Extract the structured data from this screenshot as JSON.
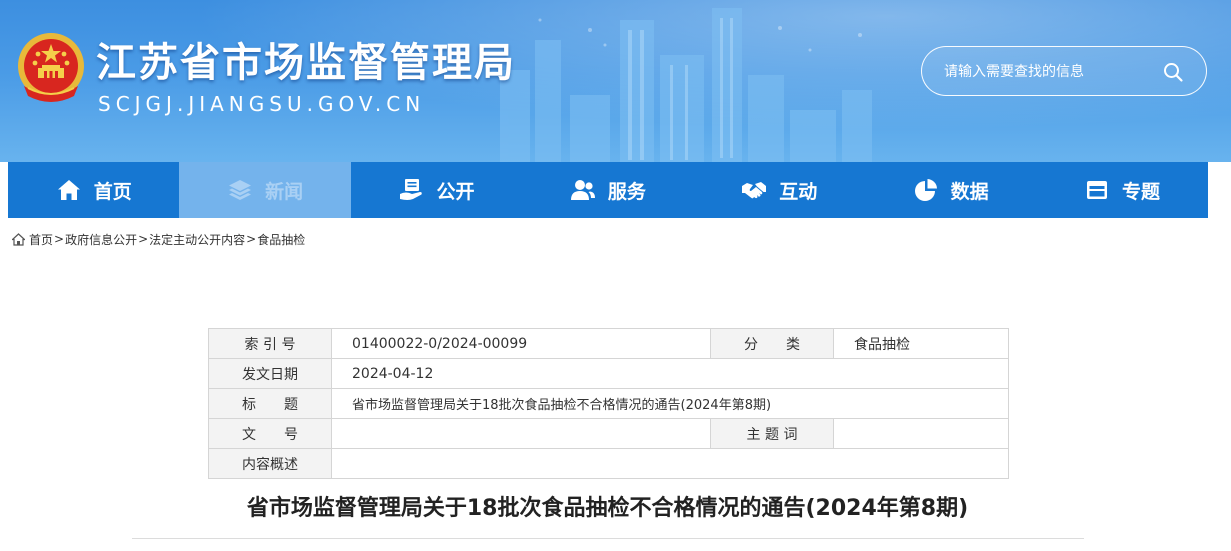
{
  "header": {
    "site_title": "江苏省市场监督管理局",
    "site_domain": "SCJGJ.JIANGSU.GOV.CN",
    "search_placeholder": "请输入需要查找的信息",
    "search_icon": "search-icon"
  },
  "nav": {
    "items": [
      {
        "label": "首页",
        "icon": "home-icon"
      },
      {
        "label": "新闻",
        "icon": "layers-icon",
        "active": true
      },
      {
        "label": "公开",
        "icon": "document-hand-icon"
      },
      {
        "label": "服务",
        "icon": "users-icon"
      },
      {
        "label": "互动",
        "icon": "handshake-icon"
      },
      {
        "label": "数据",
        "icon": "pie-chart-icon"
      },
      {
        "label": "专题",
        "icon": "window-icon"
      }
    ]
  },
  "breadcrumb": {
    "icon": "home-icon",
    "separator": ">",
    "items": [
      "首页",
      "政府信息公开",
      "法定主动公开内容",
      "食品抽检"
    ]
  },
  "info_table": {
    "index_label": "索 引 号",
    "index_value": "01400022-0/2024-00099",
    "category_label": "分　　类",
    "category_value": "食品抽检",
    "date_label": "发文日期",
    "date_value": "2024-04-12",
    "title_label": "标　　题",
    "title_value": "省市场监督管理局关于18批次食品抽检不合格情况的通告(2024年第8期)",
    "docno_label": "文　　号",
    "docno_value": "",
    "keyword_label": "主 题 词",
    "keyword_value": "",
    "summary_label": "内容概述",
    "summary_value": ""
  },
  "article": {
    "title": "省市场监督管理局关于18批次食品抽检不合格情况的通告(2024年第8期)"
  },
  "colors": {
    "header_blue": "#3d8fe0",
    "nav_blue": "#1677d2",
    "nav_active": "#74b3ec",
    "table_label_bg": "#f3f3f3"
  }
}
